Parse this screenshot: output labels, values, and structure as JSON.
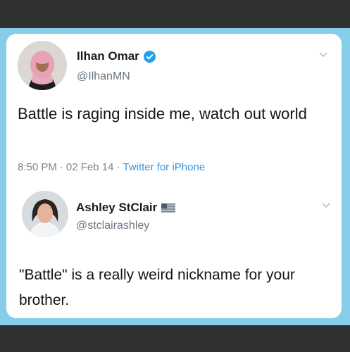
{
  "tweet1": {
    "name": "Ilhan Omar",
    "handle": "@IlhanMN",
    "verified_icon": "verified-badge-icon",
    "text": "Battle is raging inside me, watch out world",
    "time": "8:50 PM",
    "date": "02 Feb 14",
    "source": "Twitter for iPhone",
    "separator": "·"
  },
  "tweet2": {
    "name": "Ashley StClair",
    "handle": "@stclairashley",
    "flag_icon": "us-flag-icon",
    "text": "\"Battle\" is a really weird nickname for your brother."
  },
  "colors": {
    "frame": "#86cde9",
    "card": "#ffffff",
    "verified": "#1da1f2",
    "link": "#3b94d9"
  }
}
